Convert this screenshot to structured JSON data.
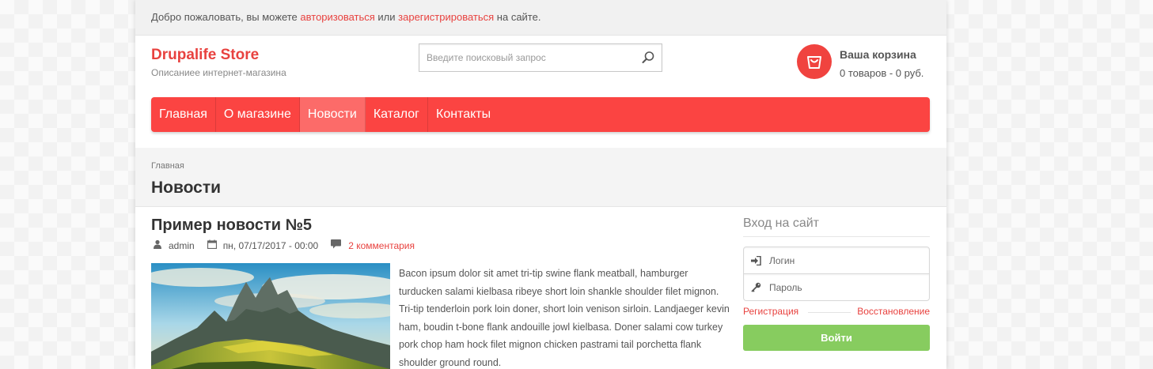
{
  "topbar": {
    "welcome_prefix": "Добро пожаловать, вы можете ",
    "login_link": "авторизоваться",
    "middle": " или ",
    "register_link": "зарегистрироваться",
    "suffix": " на сайте."
  },
  "header": {
    "site_name": "Drupalife Store",
    "slogan": "Описаниее интернет-магазина",
    "search_placeholder": "Введите поисковый запрос",
    "cart_title": "Ваша корзина",
    "cart_summary": "0 товаров - 0 руб."
  },
  "menu": {
    "items": [
      {
        "label": "Главная"
      },
      {
        "label": "О магазине"
      },
      {
        "label": "Новости",
        "active": true
      },
      {
        "label": "Каталог"
      },
      {
        "label": "Контакты"
      }
    ]
  },
  "page": {
    "breadcrumb": "Главная",
    "title": "Новости"
  },
  "node": {
    "title": "Пример новости №5",
    "author": "admin",
    "date": "пн, 07/17/2017 - 00:00",
    "comments": "2 комментария",
    "body": "Bacon ipsum dolor sit amet tri-tip swine flank meatball, hamburger turducken salami kielbasa ribeye short loin shankle shoulder filet mignon. Tri-tip tenderloin pork loin doner, short loin venison sirloin. Landjaeger kevin ham, boudin t-bone flank andouille jowl kielbasa. Doner salami cow turkey pork chop ham hock filet mignon chicken pastrami tail porchetta flank shoulder ground round."
  },
  "login": {
    "title": "Вход на сайт",
    "login_placeholder": "Логин",
    "password_placeholder": "Пароль",
    "register": "Регистрация",
    "restore": "Восстановление",
    "submit": "Войти"
  },
  "colors": {
    "accent": "#e8423f",
    "menu_bg": "#fb4442",
    "menu_active": "#fc6b69",
    "login_button": "#87cc5f"
  },
  "icons": {
    "search": "magnifier-icon",
    "cart": "basket-icon",
    "author": "user-icon",
    "date": "calendar-icon",
    "comments": "comment-icon",
    "login_field": "sign-in-icon",
    "password_field": "key-icon"
  }
}
